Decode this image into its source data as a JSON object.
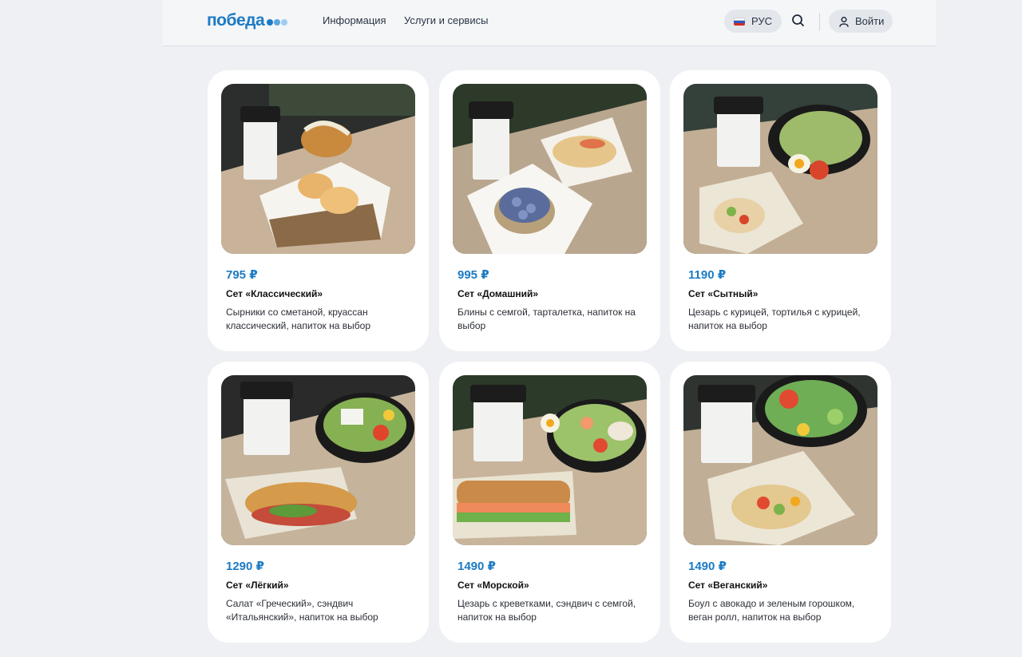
{
  "header": {
    "logo_text": "победа",
    "nav": [
      "Информация",
      "Услуги и сервисы"
    ],
    "language": "РУС",
    "login": "Войти"
  },
  "colors": {
    "brand_blue": "#1c7bc4",
    "logo_dots": [
      "#1c7bc4",
      "#5aa7df",
      "#9fcbee"
    ]
  },
  "cards": [
    {
      "price": "795 ₽",
      "name": "Сет «Классический»",
      "desc": "Сырники со сметаной, круассан классический, напиток на выбор"
    },
    {
      "price": "995 ₽",
      "name": "Сет «Домашний»",
      "desc": "Блины с семгой, тарталетка, напиток на выбор"
    },
    {
      "price": "1190 ₽",
      "name": "Сет «Сытный»",
      "desc": "Цезарь с курицей, тортилья с курицей, напиток на выбор"
    },
    {
      "price": "1290 ₽",
      "name": "Сет «Лёгкий»",
      "desc": "Салат «Греческий», сэндвич «Итальянский», напиток на выбор"
    },
    {
      "price": "1490 ₽",
      "name": "Сет «Морской»",
      "desc": "Цезарь с креветками, сэндвич с семгой, напиток на выбор"
    },
    {
      "price": "1490 ₽",
      "name": "Сет «Веганский»",
      "desc": "Боул с авокадо и зеленым горошком, веган ролл, напиток на выбор"
    }
  ]
}
